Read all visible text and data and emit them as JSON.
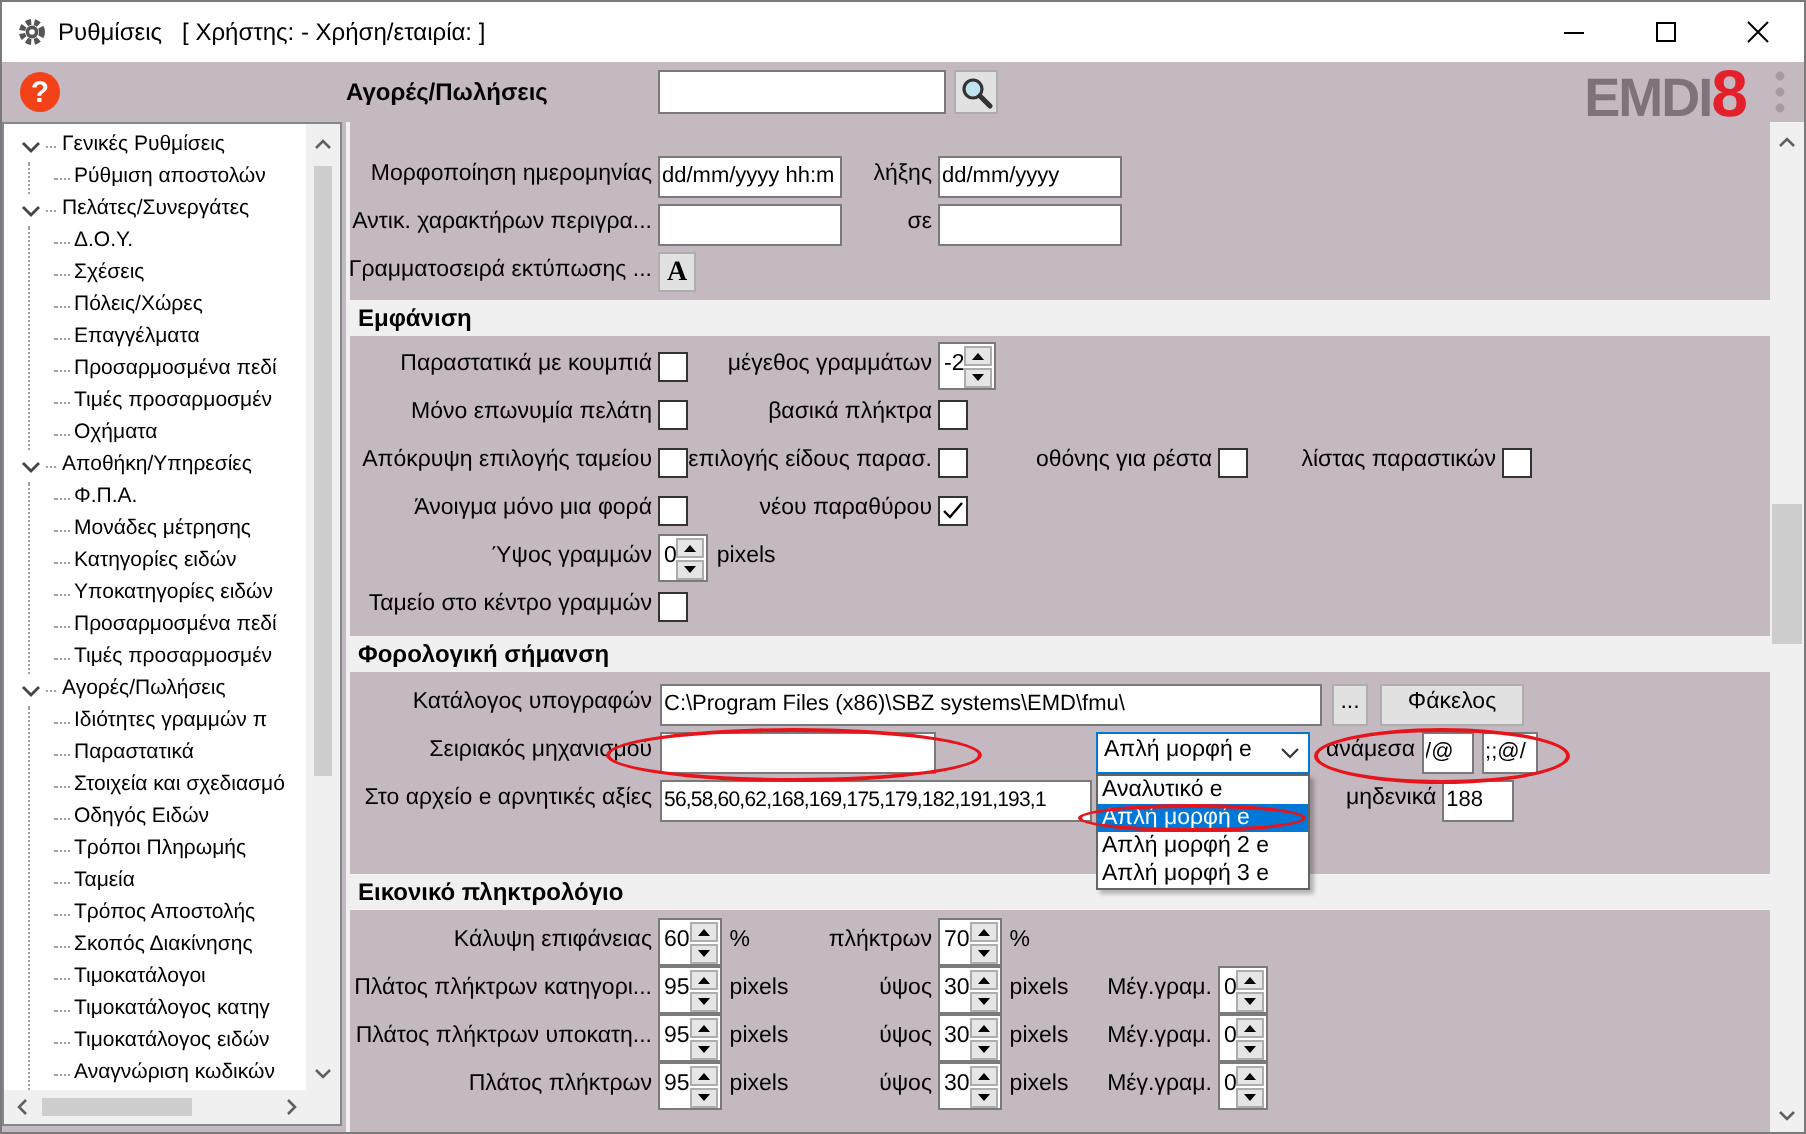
{
  "window": {
    "title": "Ρυθμίσεις",
    "subtitle": "[ Χρήστης: - Χρήση/εταιρία: ]"
  },
  "toolbar": {
    "help": "?",
    "section_title": "Αγορές/Πωλήσεις",
    "logo": {
      "text": "EMDI",
      "accent": "8"
    }
  },
  "tree": [
    {
      "label": "Γενικές Ρυθμίσεις",
      "expanded": true,
      "children": [
        {
          "label": "Ρύθμιση αποστολών"
        }
      ]
    },
    {
      "label": "Πελάτες/Συνεργάτες",
      "expanded": true,
      "children": [
        {
          "label": "Δ.Ο.Υ."
        },
        {
          "label": "Σχέσεις"
        },
        {
          "label": "Πόλεις/Χώρες"
        },
        {
          "label": "Επαγγέλματα"
        },
        {
          "label": "Προσαρμοσμένα πεδί"
        },
        {
          "label": "Τιμές προσαρμοσμέν"
        },
        {
          "label": "Οχήματα"
        }
      ]
    },
    {
      "label": "Αποθήκη/Υπηρεσίες",
      "expanded": true,
      "children": [
        {
          "label": "Φ.Π.Α."
        },
        {
          "label": "Μονάδες μέτρησης"
        },
        {
          "label": "Κατηγορίες ειδών"
        },
        {
          "label": "Υποκατηγορίες ειδών"
        },
        {
          "label": "Προσαρμοσμένα πεδί"
        },
        {
          "label": "Τιμές προσαρμοσμέν"
        }
      ]
    },
    {
      "label": "Αγορές/Πωλήσεις",
      "expanded": true,
      "children": [
        {
          "label": "Ιδιότητες γραμμών π"
        },
        {
          "label": "Παραστατικά"
        },
        {
          "label": "Στοιχεία και σχεδιασμό"
        },
        {
          "label": "Οδηγός Ειδών"
        },
        {
          "label": "Τρόποι Πληρωμής"
        },
        {
          "label": "Ταμεία"
        },
        {
          "label": "Τρόπος Αποστολής"
        },
        {
          "label": "Σκοπός Διακίνησης"
        },
        {
          "label": "Τιμοκατάλογοι"
        },
        {
          "label": "Τιμοκατάλογος κατηγ"
        },
        {
          "label": "Τιμοκατάλογος ειδών"
        },
        {
          "label": "Αναγνώριση κωδικών"
        }
      ]
    }
  ],
  "sections": [
    {
      "kind": "grid",
      "rows": [
        {
          "cells": [
            {
              "label": "Μορφοποίηση ημερομηνίας",
              "kind": "input",
              "value": "dd/mm/yyyy hh:m"
            },
            {
              "label": "λήξης",
              "kind": "input",
              "value": "dd/mm/yyyy"
            }
          ]
        },
        {
          "cells": [
            {
              "label": "Αντικ. χαρακτήρων περιγρα...",
              "kind": "input"
            },
            {
              "label": "σε",
              "kind": "input"
            }
          ]
        },
        {
          "cells": [
            {
              "label": "Γραμματοσειρά εκτύπωσης ...",
              "kind": "font-button",
              "value": "A"
            }
          ]
        }
      ]
    },
    {
      "kind": "grid",
      "title": "Εμφάνιση",
      "rows": [
        {
          "cells": [
            {
              "label": "Παραστατικά με κουμπιά",
              "kind": "checkbox",
              "checked": false
            },
            {
              "label": "μέγεθος γραμμάτων",
              "kind": "spinner",
              "value": "-2"
            }
          ]
        },
        {
          "cells": [
            {
              "label": "Μόνο επωνυμία πελάτη",
              "kind": "checkbox",
              "checked": false
            },
            {
              "label": "βασικά πλήκτρα",
              "kind": "checkbox",
              "checked": false
            }
          ]
        },
        {
          "cells": [
            {
              "label": "Απόκρυψη επιλογής ταμείου",
              "kind": "checkbox",
              "checked": false
            },
            {
              "label": "επιλογής είδους παρασ.",
              "kind": "checkbox",
              "checked": false
            },
            {
              "label": "οθόνης για ρέστα",
              "kind": "checkbox",
              "checked": false
            },
            {
              "label": "λίστας παραστικών",
              "kind": "checkbox",
              "checked": false
            }
          ]
        },
        {
          "cells": [
            {
              "label": "Άνοιγμα μόνο μια φορά",
              "kind": "checkbox",
              "checked": false
            },
            {
              "label": "νέου παραθύρου",
              "kind": "checkbox",
              "checked": true
            }
          ]
        },
        {
          "cells": [
            {
              "label": "Ύψος γραμμών",
              "kind": "spinner",
              "value": "0",
              "unit": "pixels"
            }
          ]
        },
        {
          "cells": [
            {
              "label": "Ταμείο στο κέντρο γραμμών",
              "kind": "checkbox",
              "checked": false
            }
          ]
        }
      ]
    },
    {
      "kind": "flow",
      "title": "Φορολογική σήμανση",
      "lines": [
        {
          "items": [
            {
              "kind": "label",
              "label": "Κατάλογος υπογραφών"
            },
            {
              "kind": "input",
              "value": "C:\\Program Files (x86)\\SBZ systems\\EMD\\fmu\\"
            },
            {
              "kind": "button",
              "label": "..."
            },
            {
              "kind": "button",
              "label": "Φάκελος"
            }
          ]
        },
        {
          "items": [
            {
              "kind": "label",
              "label": "Σειριακός μηχανισμού"
            },
            {
              "kind": "input"
            },
            {
              "kind": "select",
              "value": "Απλή μορφή e",
              "expanded": true,
              "options": [
                {
                  "label": "Αναλυτικό e",
                  "selected": false
                },
                {
                  "label": "Απλή μορφή e",
                  "selected": true
                },
                {
                  "label": "Απλή μορφή 2 e",
                  "selected": false
                },
                {
                  "label": "Απλή μορφή 3 e",
                  "selected": false
                }
              ]
            },
            {
              "kind": "label",
              "label": "ανάμεσα"
            },
            {
              "kind": "input",
              "value": "/@"
            },
            {
              "kind": "input",
              "value": ";;@/"
            }
          ]
        },
        {
          "items": [
            {
              "kind": "label",
              "label": "Στο αρχείο e αρνητικές αξίες"
            },
            {
              "kind": "input",
              "value": "56,58,60,62,168,169,175,179,182,191,193,1"
            },
            {
              "kind": "label",
              "label": "μηδενικά"
            },
            {
              "kind": "input",
              "value": "188"
            }
          ]
        }
      ]
    },
    {
      "kind": "grid",
      "title": "Εικονικό πληκτρολόγιο",
      "rows": [
        {
          "cells": [
            {
              "label": "Κάλυψη επιφάνειας",
              "kind": "spinner",
              "value": "60",
              "unit": "%"
            },
            {
              "label": "πλήκτρων",
              "kind": "spinner",
              "value": "70",
              "unit": "%"
            }
          ]
        },
        {
          "cells": [
            {
              "label": "Πλάτος πλήκτρων κατηγορι...",
              "kind": "spinner",
              "value": "95",
              "unit": "pixels"
            },
            {
              "label": "ύψος",
              "kind": "spinner",
              "value": "30",
              "unit": "pixels"
            },
            {
              "label": "Μέγ.γραμ.",
              "kind": "spinner",
              "value": "0"
            }
          ]
        },
        {
          "cells": [
            {
              "label": "Πλάτος πλήκτρων υποκατη...",
              "kind": "spinner",
              "value": "95",
              "unit": "pixels"
            },
            {
              "label": "ύψος",
              "kind": "spinner",
              "value": "30",
              "unit": "pixels"
            },
            {
              "label": "Μέγ.γραμ.",
              "kind": "spinner",
              "value": "0"
            }
          ]
        },
        {
          "cells": [
            {
              "label": "Πλάτος πλήκτρων",
              "kind": "spinner",
              "value": "95",
              "unit": "pixels"
            },
            {
              "label": "ύψος",
              "kind": "spinner",
              "value": "30",
              "unit": "pixels"
            },
            {
              "label": "Μέγ.γραμ.",
              "kind": "spinner",
              "value": "0"
            }
          ]
        }
      ]
    }
  ]
}
